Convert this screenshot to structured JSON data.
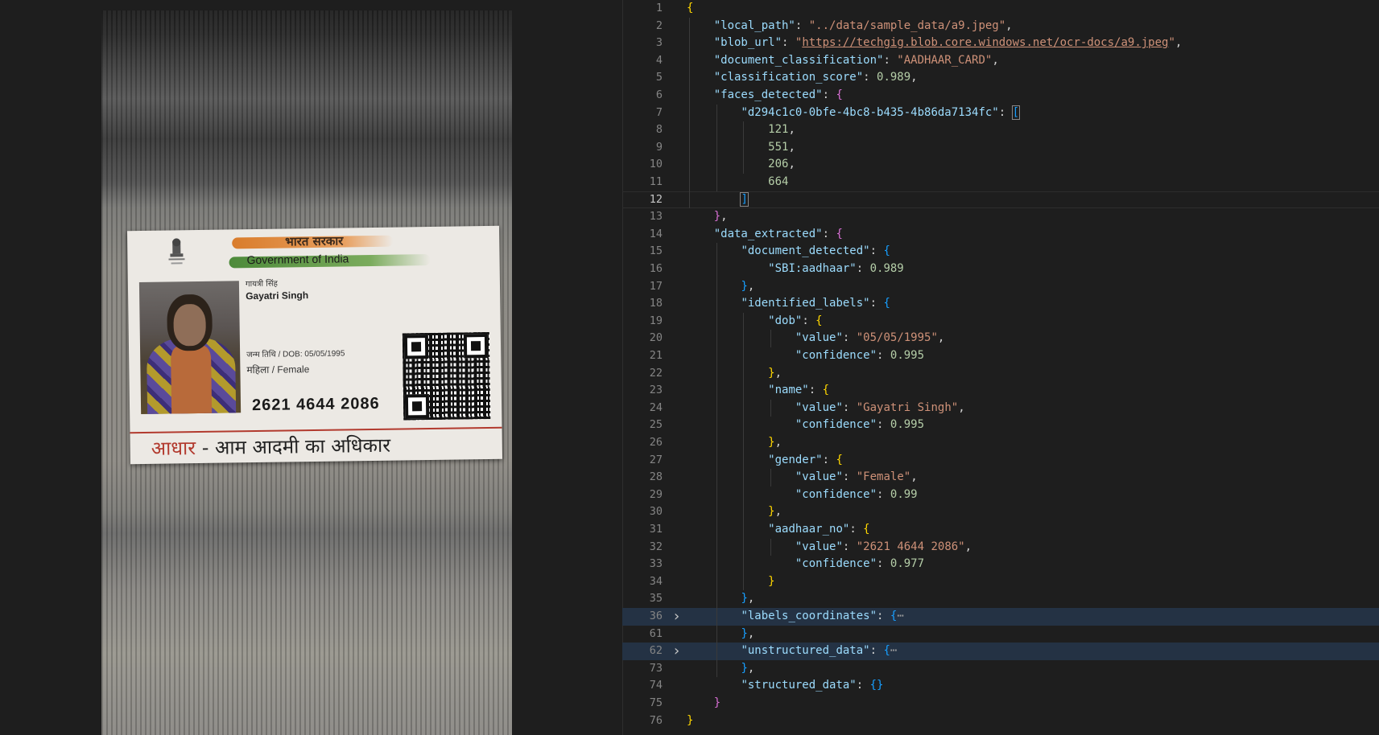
{
  "card": {
    "gov_hindi": "भारत सरकार",
    "gov_english": "Government of India",
    "name_hindi": "गायत्री सिंह",
    "name_english": "Gayatri Singh",
    "dob_line": "जन्म तिथि / DOB: 05/05/1995",
    "gender_line": "महिला / Female",
    "aadhaar_number": "2621 4644 2086",
    "tagline_red": "आधार",
    "tagline_rest": " - आम आदमी का अधिकार"
  },
  "editor": {
    "lines": [
      {
        "n": "1",
        "t": [
          [
            "b1",
            "{"
          ]
        ]
      },
      {
        "n": "2",
        "t": [
          [
            "k",
            "\"local_path\""
          ],
          [
            "p",
            ": "
          ],
          [
            "s",
            "\"../data/sample_data/a9.jpeg\""
          ],
          [
            "p",
            ","
          ]
        ]
      },
      {
        "n": "3",
        "t": [
          [
            "k",
            "\"blob_url\""
          ],
          [
            "p",
            ": "
          ],
          [
            "s",
            "\""
          ],
          [
            "u",
            "https://techgig.blob.core.windows.net/ocr-docs/a9.jpeg"
          ],
          [
            "s",
            "\""
          ],
          [
            "p",
            ","
          ]
        ]
      },
      {
        "n": "4",
        "t": [
          [
            "k",
            "\"document_classification\""
          ],
          [
            "p",
            ": "
          ],
          [
            "s",
            "\"AADHAAR_CARD\""
          ],
          [
            "p",
            ","
          ]
        ]
      },
      {
        "n": "5",
        "t": [
          [
            "k",
            "\"classification_score\""
          ],
          [
            "p",
            ": "
          ],
          [
            "n",
            "0.989"
          ],
          [
            "p",
            ","
          ]
        ]
      },
      {
        "n": "6",
        "t": [
          [
            "k",
            "\"faces_detected\""
          ],
          [
            "p",
            ": "
          ],
          [
            "b2",
            "{"
          ]
        ]
      },
      {
        "n": "7",
        "t": [
          [
            "k",
            "\"d294c1c0-0bfe-4bc8-b435-4b86da7134fc\""
          ],
          [
            "p",
            ": "
          ],
          [
            "b3",
            "["
          ]
        ]
      },
      {
        "n": "8",
        "t": [
          [
            "n",
            "121"
          ],
          [
            "p",
            ","
          ]
        ]
      },
      {
        "n": "9",
        "t": [
          [
            "n",
            "551"
          ],
          [
            "p",
            ","
          ]
        ]
      },
      {
        "n": "10",
        "t": [
          [
            "n",
            "206"
          ],
          [
            "p",
            ","
          ]
        ]
      },
      {
        "n": "11",
        "t": [
          [
            "n",
            "664"
          ]
        ]
      },
      {
        "n": "12",
        "t": [
          [
            "b3",
            "]"
          ]
        ]
      },
      {
        "n": "13",
        "t": [
          [
            "b2",
            "}"
          ],
          [
            "p",
            ","
          ]
        ]
      },
      {
        "n": "14",
        "t": [
          [
            "k",
            "\"data_extracted\""
          ],
          [
            "p",
            ": "
          ],
          [
            "b2",
            "{"
          ]
        ]
      },
      {
        "n": "15",
        "t": [
          [
            "k",
            "\"document_detected\""
          ],
          [
            "p",
            ": "
          ],
          [
            "b3",
            "{"
          ]
        ]
      },
      {
        "n": "16",
        "t": [
          [
            "k",
            "\"SBI:aadhaar\""
          ],
          [
            "p",
            ": "
          ],
          [
            "n",
            "0.989"
          ]
        ]
      },
      {
        "n": "17",
        "t": [
          [
            "b3",
            "}"
          ],
          [
            "p",
            ","
          ]
        ]
      },
      {
        "n": "18",
        "t": [
          [
            "k",
            "\"identified_labels\""
          ],
          [
            "p",
            ": "
          ],
          [
            "b3",
            "{"
          ]
        ]
      },
      {
        "n": "19",
        "t": [
          [
            "k",
            "\"dob\""
          ],
          [
            "p",
            ": "
          ],
          [
            "b1",
            "{"
          ]
        ]
      },
      {
        "n": "20",
        "t": [
          [
            "k",
            "\"value\""
          ],
          [
            "p",
            ": "
          ],
          [
            "s",
            "\"05/05/1995\""
          ],
          [
            "p",
            ","
          ]
        ]
      },
      {
        "n": "21",
        "t": [
          [
            "k",
            "\"confidence\""
          ],
          [
            "p",
            ": "
          ],
          [
            "n",
            "0.995"
          ]
        ]
      },
      {
        "n": "22",
        "t": [
          [
            "b1",
            "}"
          ],
          [
            "p",
            ","
          ]
        ]
      },
      {
        "n": "23",
        "t": [
          [
            "k",
            "\"name\""
          ],
          [
            "p",
            ": "
          ],
          [
            "b1",
            "{"
          ]
        ]
      },
      {
        "n": "24",
        "t": [
          [
            "k",
            "\"value\""
          ],
          [
            "p",
            ": "
          ],
          [
            "s",
            "\"Gayatri Singh\""
          ],
          [
            "p",
            ","
          ]
        ]
      },
      {
        "n": "25",
        "t": [
          [
            "k",
            "\"confidence\""
          ],
          [
            "p",
            ": "
          ],
          [
            "n",
            "0.995"
          ]
        ]
      },
      {
        "n": "26",
        "t": [
          [
            "b1",
            "}"
          ],
          [
            "p",
            ","
          ]
        ]
      },
      {
        "n": "27",
        "t": [
          [
            "k",
            "\"gender\""
          ],
          [
            "p",
            ": "
          ],
          [
            "b1",
            "{"
          ]
        ]
      },
      {
        "n": "28",
        "t": [
          [
            "k",
            "\"value\""
          ],
          [
            "p",
            ": "
          ],
          [
            "s",
            "\"Female\""
          ],
          [
            "p",
            ","
          ]
        ]
      },
      {
        "n": "29",
        "t": [
          [
            "k",
            "\"confidence\""
          ],
          [
            "p",
            ": "
          ],
          [
            "n",
            "0.99"
          ]
        ]
      },
      {
        "n": "30",
        "t": [
          [
            "b1",
            "}"
          ],
          [
            "p",
            ","
          ]
        ]
      },
      {
        "n": "31",
        "t": [
          [
            "k",
            "\"aadhaar_no\""
          ],
          [
            "p",
            ": "
          ],
          [
            "b1",
            "{"
          ]
        ]
      },
      {
        "n": "32",
        "t": [
          [
            "k",
            "\"value\""
          ],
          [
            "p",
            ": "
          ],
          [
            "s",
            "\"2621 4644 2086\""
          ],
          [
            "p",
            ","
          ]
        ]
      },
      {
        "n": "33",
        "t": [
          [
            "k",
            "\"confidence\""
          ],
          [
            "p",
            ": "
          ],
          [
            "n",
            "0.977"
          ]
        ]
      },
      {
        "n": "34",
        "t": [
          [
            "b1",
            "}"
          ]
        ]
      },
      {
        "n": "35",
        "t": [
          [
            "b3",
            "}"
          ],
          [
            "p",
            ","
          ]
        ]
      },
      {
        "n": "36",
        "t": [
          [
            "k",
            "\"labels_coordinates\""
          ],
          [
            "p",
            ": "
          ],
          [
            "b3",
            "{"
          ],
          [
            "e",
            "⋯"
          ]
        ]
      },
      {
        "n": "61",
        "t": [
          [
            "b3",
            "}"
          ],
          [
            "p",
            ","
          ]
        ]
      },
      {
        "n": "62",
        "t": [
          [
            "k",
            "\"unstructured_data\""
          ],
          [
            "p",
            ": "
          ],
          [
            "b3",
            "{"
          ],
          [
            "e",
            "⋯"
          ]
        ]
      },
      {
        "n": "73",
        "t": [
          [
            "b3",
            "}"
          ],
          [
            "p",
            ","
          ]
        ]
      },
      {
        "n": "74",
        "t": [
          [
            "k",
            "\"structured_data\""
          ],
          [
            "p",
            ": "
          ],
          [
            "b3",
            "{}"
          ]
        ]
      },
      {
        "n": "75",
        "t": [
          [
            "b2",
            "}"
          ]
        ]
      },
      {
        "n": "76",
        "t": [
          [
            "b1",
            "}"
          ]
        ]
      }
    ]
  }
}
